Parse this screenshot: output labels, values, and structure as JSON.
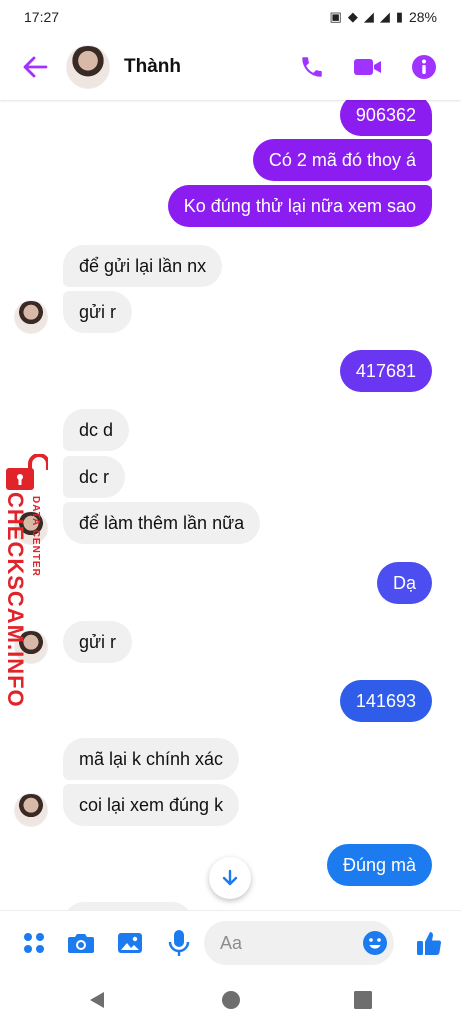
{
  "status_bar": {
    "time": "17:27",
    "battery": "28%"
  },
  "header": {
    "contact_name": "Thành"
  },
  "colors": {
    "accent": "#a033ff",
    "bubble_purple": "#8b1df0",
    "bubble_blue": "#2f5ce8",
    "bubble_light_blue": "#1d7bf0",
    "incoming": "#f0f0f0",
    "watermark": "#e0242a"
  },
  "messages": [
    {
      "dir": "out",
      "text": "906362"
    },
    {
      "dir": "out",
      "text": "Có 2 mã đó thoy á"
    },
    {
      "dir": "out",
      "text": "Ko đúng thử lại nữa xem sao"
    },
    {
      "dir": "in",
      "text": "để gửi lại lần nx"
    },
    {
      "dir": "in",
      "text": "gửi r"
    },
    {
      "dir": "out",
      "text": "417681"
    },
    {
      "dir": "in",
      "text": "dc d"
    },
    {
      "dir": "in",
      "text": "dc r"
    },
    {
      "dir": "in",
      "text": "để làm thêm lần nữa"
    },
    {
      "dir": "out",
      "text": "Dạ"
    },
    {
      "dir": "in",
      "text": "gửi r"
    },
    {
      "dir": "out",
      "text": "141693"
    },
    {
      "dir": "in",
      "text": "mã lại k chính xác"
    },
    {
      "dir": "in",
      "text": "coi lại xem đúng k"
    },
    {
      "dir": "out",
      "text": "Đúng mà"
    }
  ],
  "watermark": {
    "main": "CHECKSCAM.INFO",
    "sub": "DATA CENTER"
  },
  "composer": {
    "placeholder": "Aa"
  },
  "icons": [
    "back-arrow-icon",
    "phone-icon",
    "video-icon",
    "info-icon",
    "apps-icon",
    "camera-icon",
    "gallery-icon",
    "mic-icon",
    "emoji-icon",
    "like-icon",
    "chevron-down-icon"
  ]
}
